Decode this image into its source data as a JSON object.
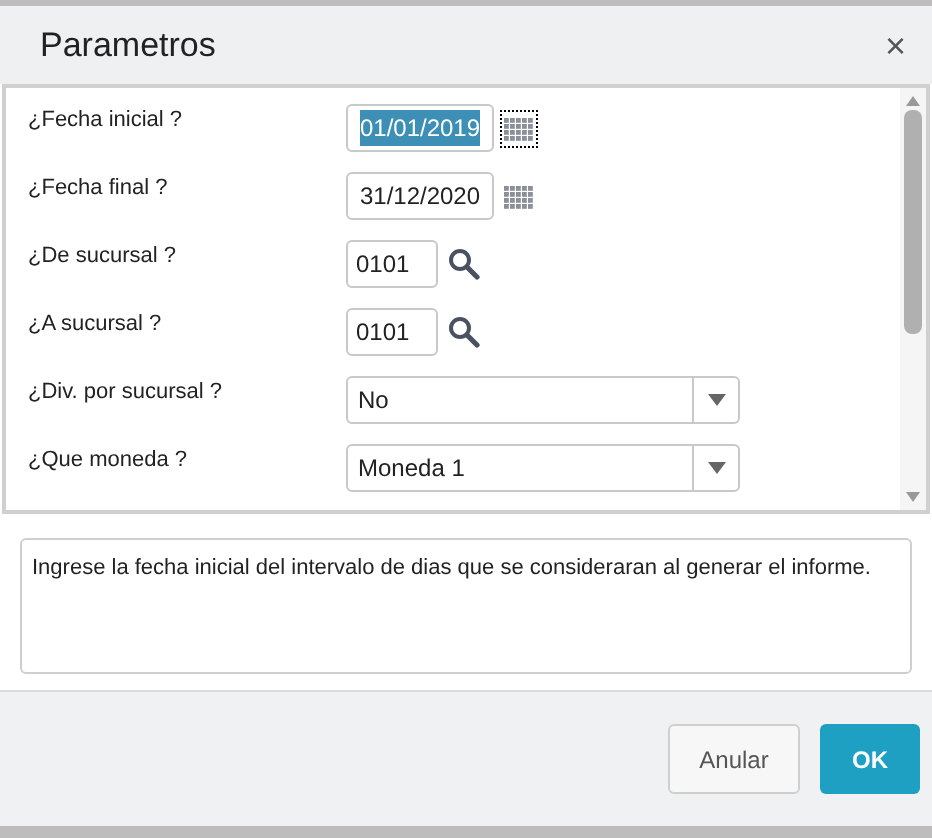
{
  "dialog": {
    "title": "Parametros",
    "close": "×"
  },
  "parameters": [
    {
      "label": "¿Fecha inicial ?",
      "kind": "date",
      "value": "01/01/2019",
      "highlighted": true
    },
    {
      "label": "¿Fecha final ?",
      "kind": "date",
      "value": "31/12/2020",
      "highlighted": false
    },
    {
      "label": "¿De sucursal ?",
      "kind": "lookup",
      "value": "0101",
      "highlighted": false
    },
    {
      "label": "¿A sucursal ?",
      "kind": "lookup",
      "value": "0101",
      "highlighted": false
    },
    {
      "label": "¿Div. por sucursal ?",
      "kind": "select",
      "value": "No",
      "highlighted": false
    },
    {
      "label": "¿Que moneda ?",
      "kind": "select",
      "value": "Moneda 1",
      "highlighted": false
    }
  ],
  "help_text": "Ingrese la fecha inicial del intervalo de dias que se consideraran al generar el informe.",
  "buttons": [
    {
      "label": "Anular",
      "kind": "secondary"
    },
    {
      "label": "OK",
      "kind": "primary"
    }
  ]
}
